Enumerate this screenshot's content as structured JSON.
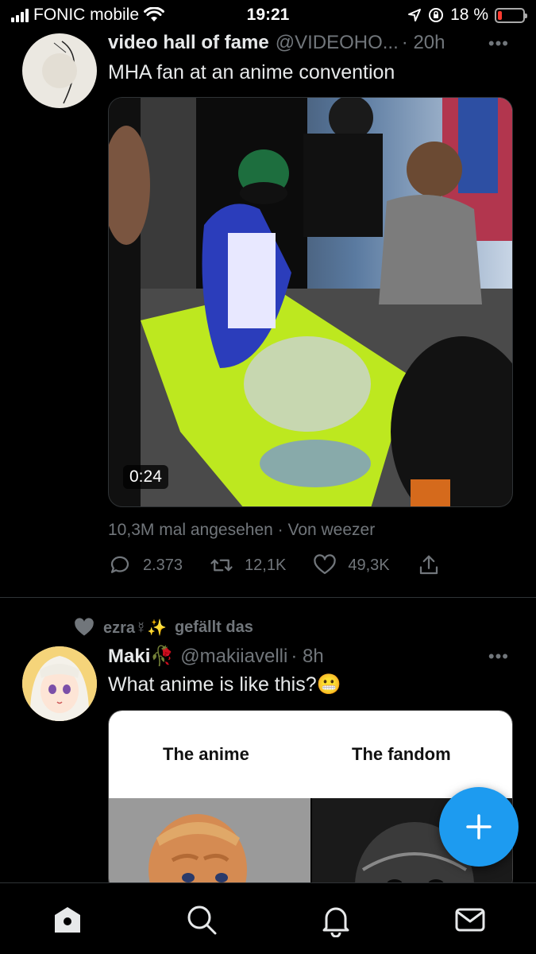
{
  "status_bar": {
    "carrier": "FONIC mobile",
    "time": "19:21",
    "battery_percent_text": "18 %",
    "battery_level": 0.18,
    "icons": [
      "signal-icon",
      "wifi-icon",
      "location-icon",
      "orientation-lock-icon",
      "battery-icon"
    ]
  },
  "tweet1": {
    "author_name": "video hall of fame",
    "handle": "@VIDEOHO...",
    "time": "· 20h",
    "text": "MHA fan at an anime convention",
    "video_duration": "0:24",
    "views": "10,3M mal angesehen · Von weezer",
    "replies": "2.373",
    "retweets": "12,1K",
    "likes": "49,3K"
  },
  "liked_by": {
    "user": "ezra☿✨",
    "suffix": "gefällt das"
  },
  "tweet2": {
    "author_name": "Maki🥀",
    "handle": "@makiiavelli",
    "time": "· 8h",
    "text": "What anime is like this?😬",
    "card": {
      "left_label": "The anime",
      "right_label": "The fandom"
    }
  },
  "colors": {
    "accent": "#1d9bf0",
    "muted": "#71767b",
    "text": "#e7e9ea",
    "background": "#000000"
  },
  "tab_bar": {
    "items": [
      "home-icon",
      "search-icon",
      "notifications-icon",
      "messages-icon"
    ]
  }
}
